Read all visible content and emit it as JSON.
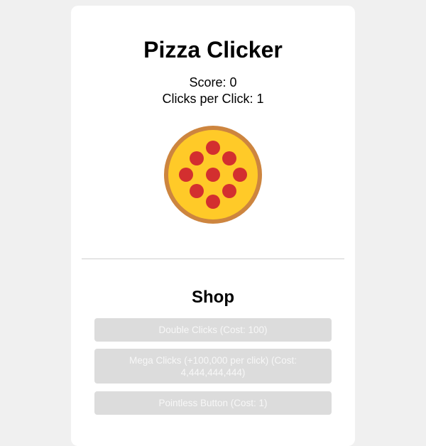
{
  "app": {
    "title": "Pizza Clicker"
  },
  "stats": {
    "score": "Score: 0",
    "clicks_per_click": "Clicks per Click: 1"
  },
  "pizza": {
    "icon": "pizza-icon",
    "colors": {
      "crust": "#cd853f",
      "cheese": "#ffca28",
      "pepperoni": "#d32f2f"
    }
  },
  "shop": {
    "title": "Shop",
    "items": [
      {
        "label": "Double Clicks (Cost: 100)",
        "enabled": false
      },
      {
        "label": "Mega Clicks (+100,000 per click) (Cost: 4,444,444,444)",
        "enabled": false
      },
      {
        "label": "Pointless Button (Cost: 1)",
        "enabled": false
      }
    ]
  },
  "colors": {
    "page_background": "#f0f0f0",
    "card_background": "#ffffff",
    "disabled_button_bg": "#dcdcdc",
    "disabled_button_text": "#f7f7f7"
  }
}
